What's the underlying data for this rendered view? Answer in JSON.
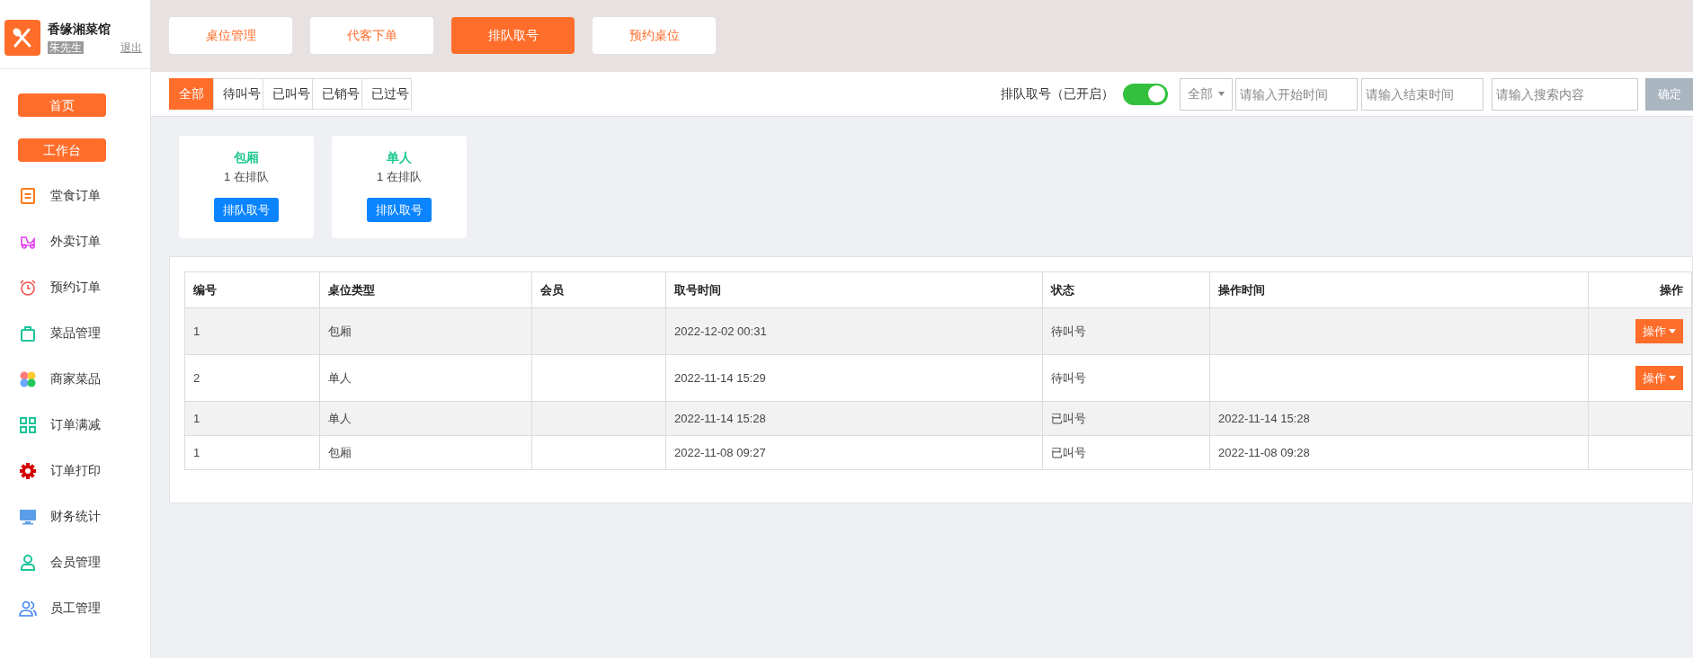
{
  "brand": {
    "name": "香缘湘菜馆",
    "user": "朱先生",
    "logout": "退出"
  },
  "sidebar": {
    "buttons": [
      "首页",
      "工作台"
    ],
    "items": [
      {
        "label": "堂食订单",
        "kind": "doc"
      },
      {
        "label": "外卖订单",
        "kind": "scooter"
      },
      {
        "label": "预约订单",
        "kind": "alarm"
      },
      {
        "label": "菜品管理",
        "kind": "bag"
      },
      {
        "label": "商家菜品",
        "kind": "petals"
      },
      {
        "label": "订单满减",
        "kind": "grid"
      },
      {
        "label": "订单打印",
        "kind": "gear"
      },
      {
        "label": "财务统计",
        "kind": "monitor"
      },
      {
        "label": "会员管理",
        "kind": "user"
      },
      {
        "label": "员工管理",
        "kind": "users"
      }
    ]
  },
  "top_tabs": [
    {
      "label": "桌位管理",
      "selected": false
    },
    {
      "label": "代客下单",
      "selected": false
    },
    {
      "label": "排队取号",
      "selected": true
    },
    {
      "label": "预约桌位",
      "selected": false
    }
  ],
  "filter_tabs": [
    {
      "label": "全部",
      "selected": true
    },
    {
      "label": "待叫号",
      "selected": false
    },
    {
      "label": "已叫号",
      "selected": false
    },
    {
      "label": "已销号",
      "selected": false
    },
    {
      "label": "已过号",
      "selected": false
    }
  ],
  "queue_switch": {
    "label": "排队取号（已开启）",
    "on": true
  },
  "filters": {
    "select": "全部",
    "start": {
      "placeholder": "请输入开始时间"
    },
    "end": {
      "placeholder": "请输入结束时间"
    },
    "search": {
      "placeholder": "请输入搜索内容"
    },
    "confirm": "确定"
  },
  "cards": [
    {
      "title": "包厢",
      "count": "1 在排队",
      "button": "排队取号"
    },
    {
      "title": "单人",
      "count": "1 在排队",
      "button": "排队取号"
    }
  ],
  "table": {
    "columns": [
      "编号",
      "桌位类型",
      "会员",
      "取号时间",
      "状态",
      "操作时间",
      "操作"
    ],
    "rows": [
      {
        "cells": [
          "1",
          "包厢",
          "",
          "2022-12-02 00:31",
          "待叫号",
          ""
        ],
        "action": "操作"
      },
      {
        "cells": [
          "2",
          "单人",
          "",
          "2022-11-14 15:29",
          "待叫号",
          ""
        ],
        "action": "操作"
      },
      {
        "cells": [
          "1",
          "单人",
          "",
          "2022-11-14 15:28",
          "已叫号",
          "2022-11-14 15:28"
        ]
      },
      {
        "cells": [
          "1",
          "包厢",
          "",
          "2022-11-08 09:27",
          "已叫号",
          "2022-11-08 09:28"
        ]
      }
    ]
  }
}
